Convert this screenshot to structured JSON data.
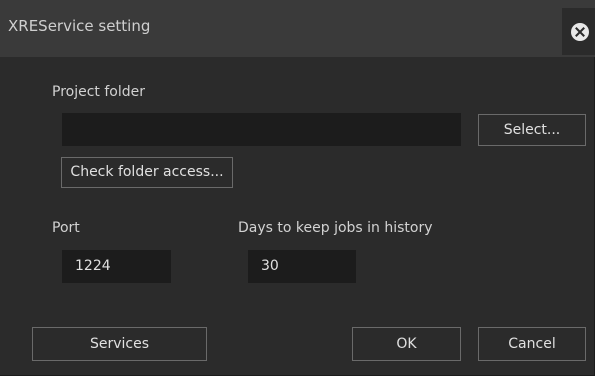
{
  "window": {
    "title": "XREService setting",
    "close_icon": "close-circle-icon"
  },
  "project_folder": {
    "label": "Project folder",
    "value": "",
    "select_label": "Select...",
    "check_access_label": "Check folder access..."
  },
  "port": {
    "label": "Port",
    "value": "1224"
  },
  "history": {
    "label": "Days to keep jobs in history",
    "value": "30"
  },
  "buttons": {
    "services": "Services",
    "ok": "OK",
    "cancel": "Cancel"
  },
  "colors": {
    "background": "#2b2b2b",
    "titlebar": "#3a3a3a",
    "field": "#1c1c1c",
    "button_border": "#6a6a6a",
    "text": "#d6d6d6"
  }
}
